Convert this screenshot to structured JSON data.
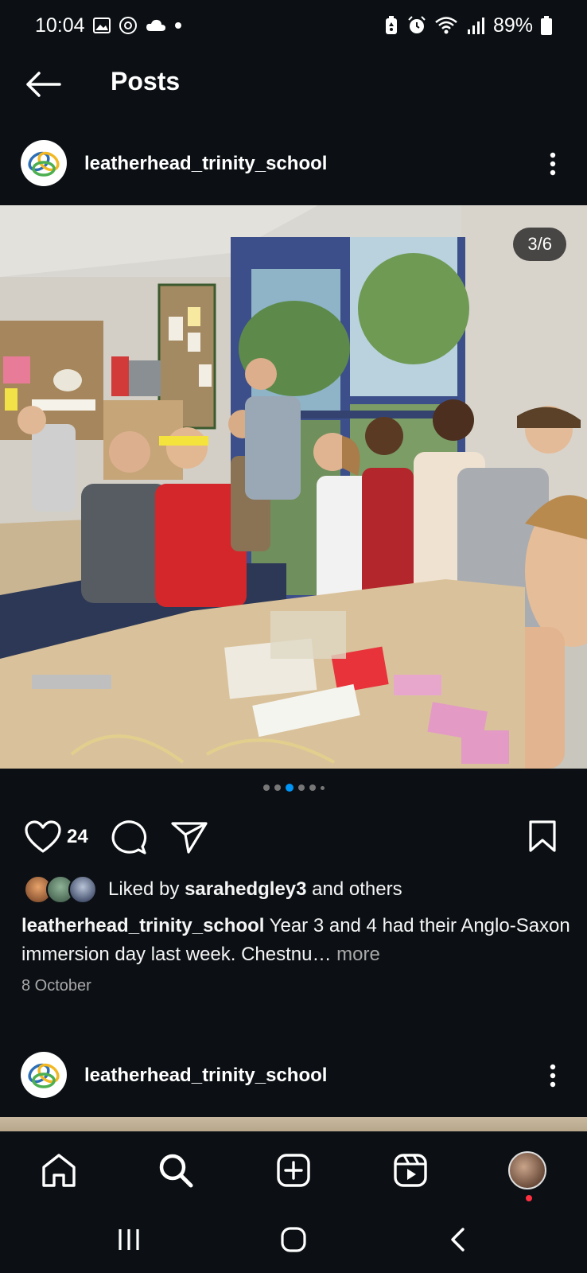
{
  "status_bar": {
    "time": "10:04",
    "battery": "89%",
    "icons": [
      "image-icon",
      "threads-icon",
      "cloud-icon",
      "dot-icon",
      "battery-saver-icon",
      "alarm-icon",
      "wifi-icon",
      "signal-icon",
      "battery-icon"
    ]
  },
  "header": {
    "title": "Posts"
  },
  "post": {
    "username": "leatherhead_trinity_school",
    "image_counter": "3/6",
    "carousel": {
      "total": 6,
      "active_index": 2
    },
    "likes": "24",
    "liked_by_prefix": "Liked by",
    "liked_by_user": "sarahedgley3",
    "liked_by_suffix": "and others",
    "caption_user": "leatherhead_trinity_school",
    "caption_text": "Year 3 and 4 had their Anglo-Saxon immersion day last week. Chestnu…",
    "caption_more": "more",
    "date": "8 October"
  },
  "next_post": {
    "username": "leatherhead_trinity_school"
  },
  "colors": {
    "background": "#0c1014",
    "accent": "#0095f6",
    "secondary_text": "#a8a8a8",
    "notification": "#ff3040"
  }
}
